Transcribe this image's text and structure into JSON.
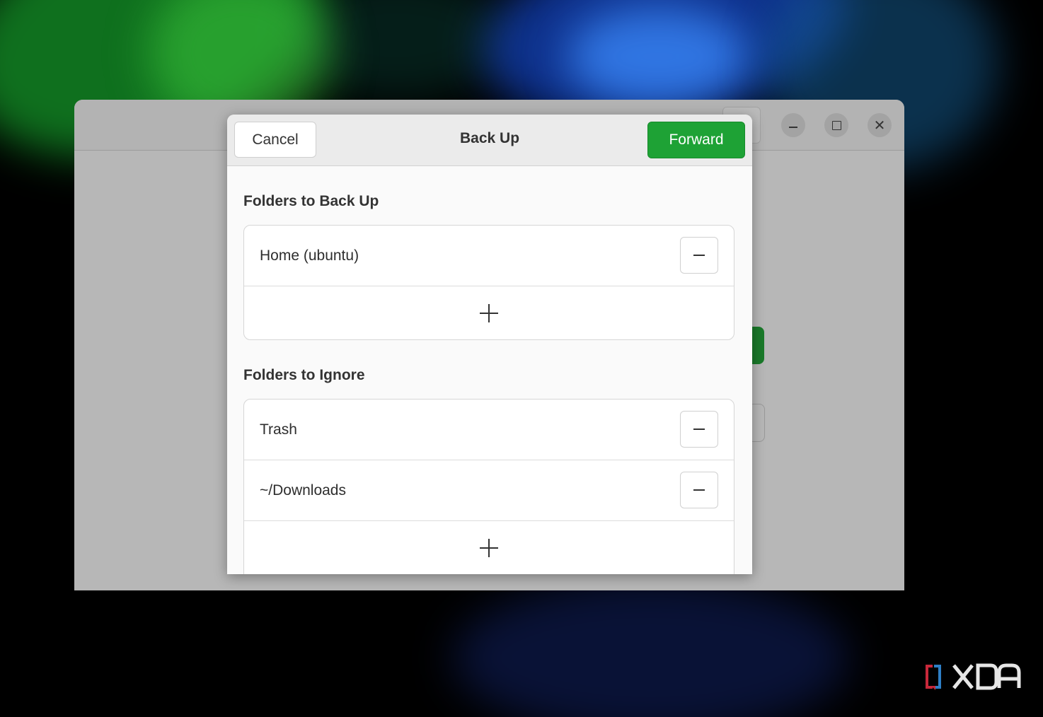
{
  "dialog": {
    "title": "Back Up",
    "cancel_label": "Cancel",
    "forward_label": "Forward",
    "accent_color": "#1ea235"
  },
  "backup_section": {
    "title": "Folders to Back Up",
    "folders": [
      {
        "label": "Home (ubuntu)",
        "action_icon": "minus-icon"
      }
    ],
    "add_icon": "plus-icon"
  },
  "ignore_section": {
    "title": "Folders to Ignore",
    "folders": [
      {
        "label": "Trash",
        "action_icon": "minus-icon"
      },
      {
        "label": "~/Downloads",
        "action_icon": "minus-icon"
      }
    ],
    "add_icon": "plus-icon"
  },
  "window_controls": [
    "minimize-icon",
    "maximize-icon",
    "close-icon"
  ],
  "watermark": "XDA"
}
